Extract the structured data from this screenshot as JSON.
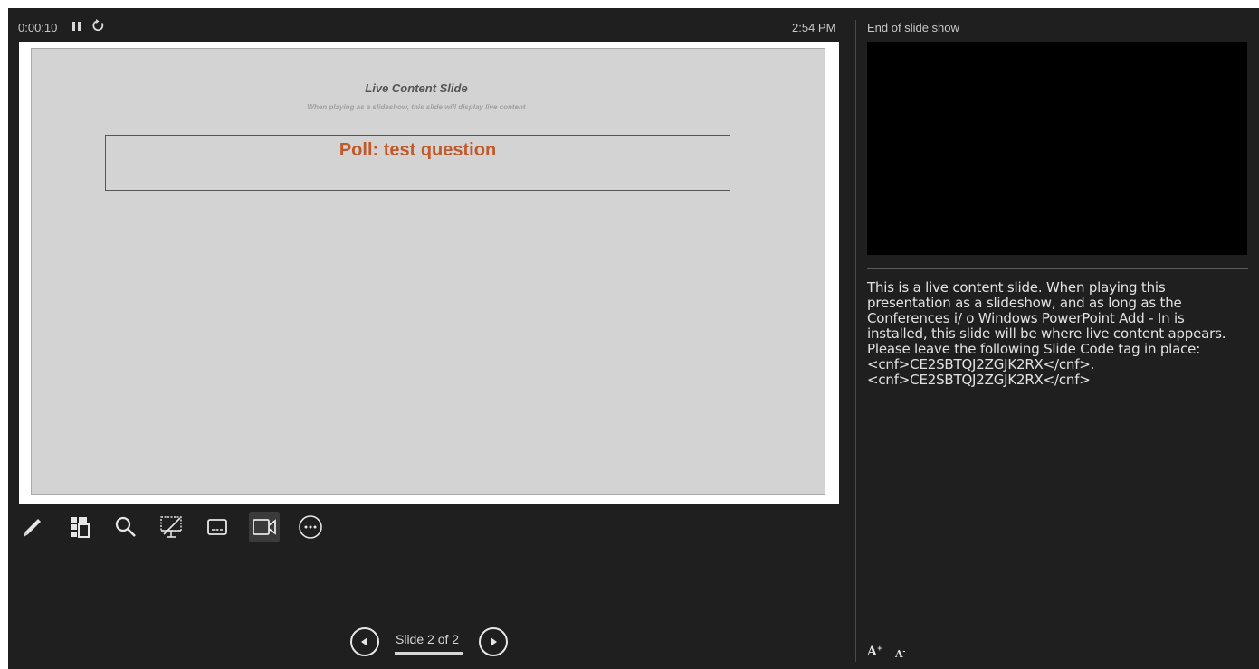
{
  "header": {
    "timer": "0:00:10",
    "clock": "2:54 PM"
  },
  "slide": {
    "title": "Live Content Slide",
    "subtitle": "When playing as a slideshow, this slide will display live content",
    "poll_title": "Poll: test question"
  },
  "toolbar": {
    "icons": [
      "pen-icon",
      "see-all-slides-icon",
      "zoom-icon",
      "black-screen-icon",
      "subtitles-icon",
      "camera-icon",
      "more-options-icon"
    ]
  },
  "navigation": {
    "slide_counter": "Slide 2 of 2"
  },
  "next_panel": {
    "label": "End of slide show"
  },
  "notes": {
    "text": "This is a live content slide. When playing this presentation as a slideshow, and as long as the Conferences i/ o Windows PowerPoint Add - In is installed, this slide will be where live content appears. Please leave the following Slide Code tag in place: <cnf>CE2SBTQJ2ZGJK2RX</cnf>. <cnf>CE2SBTQJ2ZGJK2RX</cnf>"
  },
  "colors": {
    "background": "#1f1f1f",
    "slide_bg": "#d3d3d3",
    "poll_accent": "#c05a2c"
  }
}
